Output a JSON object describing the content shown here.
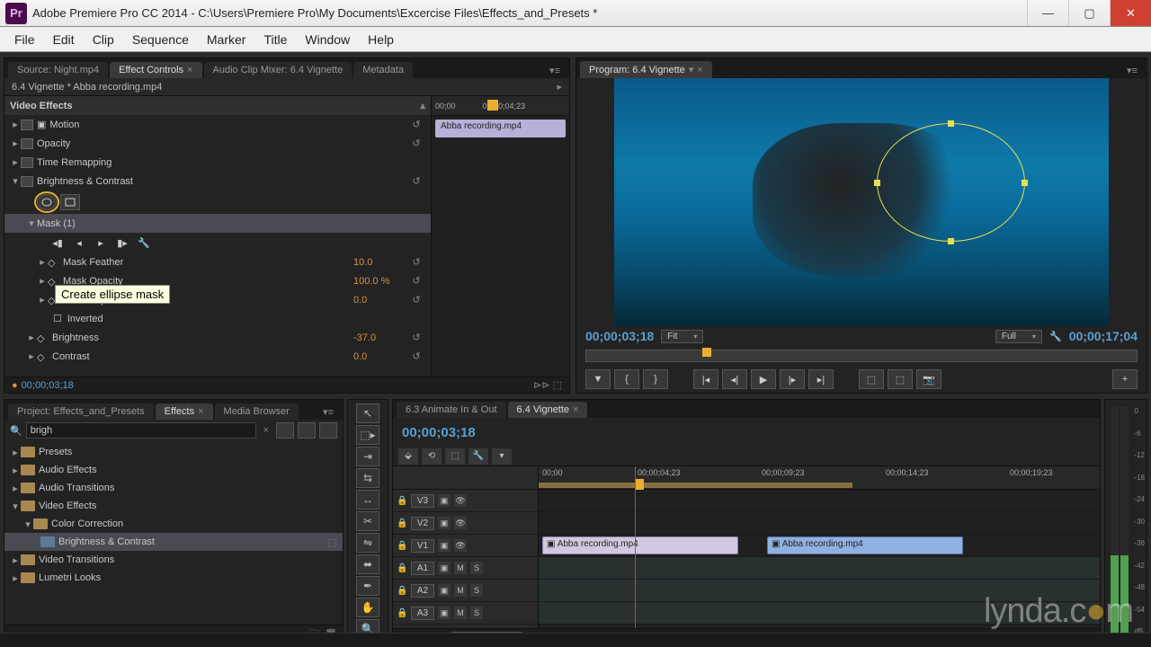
{
  "window": {
    "app_label": "Pr",
    "title": "Adobe Premiere Pro CC 2014 - C:\\Users\\Premiere Pro\\My Documents\\Excercise Files\\Effects_and_Presets *"
  },
  "menu": [
    "File",
    "Edit",
    "Clip",
    "Sequence",
    "Marker",
    "Title",
    "Window",
    "Help"
  ],
  "source_tabs": {
    "source": "Source: Night.mp4",
    "effect_controls": "Effect Controls",
    "audio_mixer": "Audio Clip Mixer: 6.4 Vignette",
    "metadata": "Metadata"
  },
  "ec": {
    "header": "6.4 Vignette * Abba recording.mp4",
    "cat": "Video Effects",
    "motion": "Motion",
    "opacity": "Opacity",
    "time_remap": "Time Remapping",
    "bc": "Brightness & Contrast",
    "tooltip": "Create ellipse mask",
    "mask": "Mask (1)",
    "mask_feather": "Mask Feather",
    "mask_feather_val": "10.0",
    "mask_opacity": "Mask Opacity",
    "mask_opacity_val": "100.0 %",
    "mask_expansion": "Mask Expansion",
    "mask_expansion_val": "0.0",
    "inverted": "Inverted",
    "brightness": "Brightness",
    "brightness_val": "-37.0",
    "contrast": "Contrast",
    "contrast_val": "0.0",
    "tl_t0": "00;00",
    "tl_t1": "00;00;04;23",
    "tl_clip": "Abba recording.mp4",
    "footer_tc": "00;00;03;18"
  },
  "program": {
    "tab": "Program: 6.4 Vignette",
    "tc_left": "00;00;03;18",
    "fit": "Fit",
    "res": "Full",
    "tc_right": "00;00;17;04"
  },
  "project": {
    "tabs": {
      "project": "Project: Effects_and_Presets",
      "effects": "Effects",
      "media": "Media Browser"
    },
    "search": "brigh",
    "nodes": {
      "presets": "Presets",
      "audio_fx": "Audio Effects",
      "audio_tr": "Audio Transitions",
      "video_fx": "Video Effects",
      "color_corr": "Color Correction",
      "bc": "Brightness & Contrast",
      "video_tr": "Video Transitions",
      "lumetri": "Lumetri Looks"
    }
  },
  "timeline": {
    "tabs": {
      "a": "6.3 Animate In & Out",
      "b": "6.4 Vignette"
    },
    "tc": "00;00;03;18",
    "ruler": [
      "00;00",
      "00;00;04;23",
      "00;00;09;23",
      "00;00;14;23",
      "00;00;19;23"
    ],
    "tracks": {
      "v3": "V3",
      "v2": "V2",
      "v1": "V1",
      "a1": "A1",
      "a2": "A2",
      "a3": "A3"
    },
    "toggles": {
      "m": "M",
      "s": "S"
    },
    "clip1": "Abba recording.mp4",
    "clip2": "Abba recording.mp4"
  },
  "meters": [
    "0",
    "-6",
    "-12",
    "-18",
    "-24",
    "-30",
    "-36",
    "-42",
    "-48",
    "-54",
    "dB"
  ],
  "watermark_a": "lynda.c",
  "watermark_b": "●",
  "watermark_c": "m"
}
